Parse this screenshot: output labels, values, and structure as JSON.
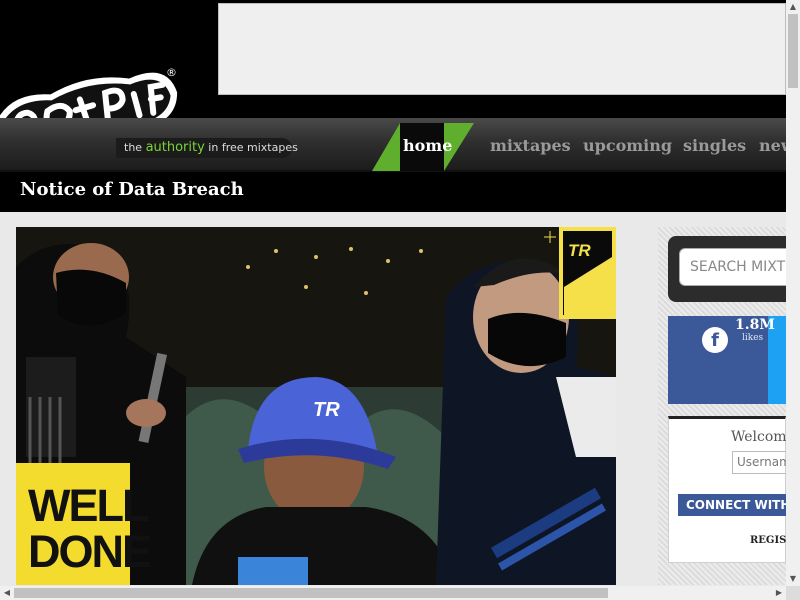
{
  "logo": {
    "registered_mark": "®",
    "tagline_pre": "the ",
    "tagline_highlight": "authority",
    "tagline_post": " in free mixtapes"
  },
  "nav": {
    "items": [
      "home",
      "mixtapes",
      "upcoming",
      "singles",
      "new"
    ]
  },
  "page": {
    "title": "Notice of Data Breach"
  },
  "hero": {
    "poster_text_1": "WELL",
    "poster_text_2": "DONE",
    "cap_logo": "TR",
    "corner_logo": "TR"
  },
  "sidebar": {
    "search_placeholder": "SEARCH MIXT",
    "facebook": {
      "count": "1.8M",
      "label": "likes"
    },
    "login": {
      "welcome": "Welcome",
      "username_placeholder": "Usernam",
      "connect_label": "CONNECT WITH F",
      "register_label": "REGIST"
    }
  },
  "colors": {
    "accent_green": "#7ad23a",
    "facebook_blue": "#3b5998",
    "twitter_blue": "#1da1f2"
  },
  "icons": {
    "facebook": "facebook-icon",
    "scroll_up": "arrow-up-icon",
    "scroll_down": "arrow-down-icon",
    "scroll_left": "arrow-left-icon",
    "scroll_right": "arrow-right-icon"
  }
}
